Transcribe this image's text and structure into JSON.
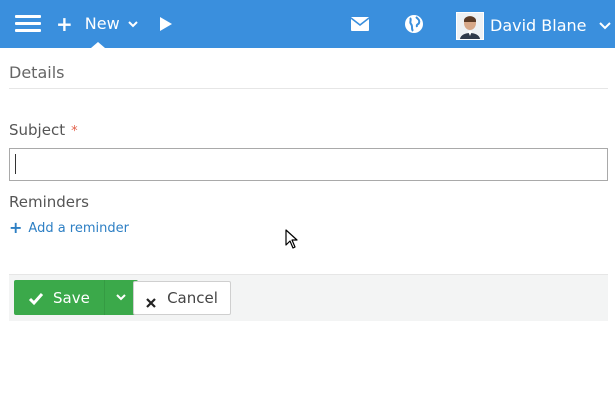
{
  "colors": {
    "topbar": "#3a8fdd",
    "accent_link": "#2d7fc4",
    "save_green": "#3ba94a",
    "required": "#e2604a"
  },
  "topbar": {
    "menu_icon": "hamburger-menu-icon",
    "new": {
      "plus_icon": "plus-icon",
      "label": "New",
      "chevron_icon": "chevron-down-icon"
    },
    "play_icon": "play-icon",
    "mail_icon": "mail-icon",
    "globe_icon": "globe-icon",
    "user": {
      "avatar_icon": "avatar",
      "name": "David Blane",
      "chevron_icon": "chevron-down-icon"
    }
  },
  "details": {
    "title": "Details"
  },
  "form": {
    "subject": {
      "label": "Subject",
      "required_mark": "*",
      "value": "",
      "placeholder": ""
    },
    "reminders": {
      "label": "Reminders",
      "add_label": "Add a reminder"
    }
  },
  "actions": {
    "save_label": "Save",
    "cancel_label": "Cancel"
  }
}
